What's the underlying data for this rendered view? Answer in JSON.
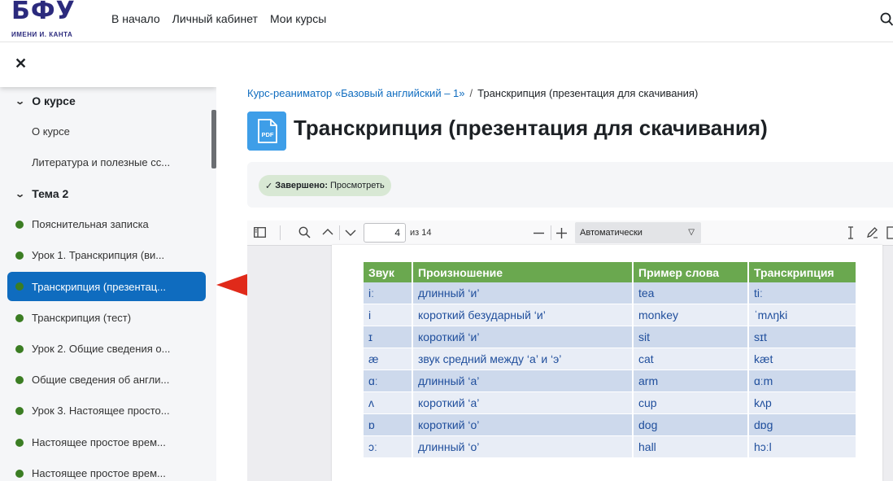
{
  "header": {
    "logo_main": "БФУ",
    "logo_sub": "ИМЕНИ И. КАНТА",
    "nav": [
      "В начало",
      "Личный кабинет",
      "Мои курсы"
    ]
  },
  "sidebar": {
    "sections": [
      {
        "title": "О курсе",
        "items": [
          "О курсе",
          "Литература и полезные сс..."
        ]
      },
      {
        "title": "Тема 2",
        "activities": [
          "Пояснительная записка",
          "Урок 1. Транскрипция (ви...",
          "Транскрипция (презентац...",
          "Транскрипция (тест)",
          "Урок 2. Общие сведения о...",
          "Общие сведения об англи...",
          "Урок 3. Настоящее просто...",
          "Настоящее простое врем...",
          "Настоящее простое врем..."
        ]
      }
    ]
  },
  "breadcrumb": {
    "course": "Курс-реаниматор «Базовый английский – 1»",
    "separator": "/",
    "current": "Транскрипция (презентация для скачивания)"
  },
  "page": {
    "icon_label": "PDF",
    "title": "Транскрипция (презентация для скачивания)",
    "completion_label": "Завершено:",
    "completion_value": "Просмотреть"
  },
  "viewer": {
    "page_number": "4",
    "page_total": "из 14",
    "zoom": "Автоматически"
  },
  "table": {
    "headers": [
      "Звук",
      "Произношение",
      "Пример слова",
      "Транскрипция"
    ],
    "rows": [
      [
        "iː",
        "длинный ‘и’",
        "tea",
        "tiː"
      ],
      [
        "i",
        "короткий безударный ‘и’",
        "monkey",
        "ˈmʌŋki"
      ],
      [
        "ɪ",
        "короткий ‘и’",
        "sit",
        "sɪt"
      ],
      [
        "æ",
        "звук средний между ‘а’ и ‘э’",
        "cat",
        "kæt"
      ],
      [
        "ɑː",
        "длинный ‘а’",
        "arm",
        "ɑːm"
      ],
      [
        "ʌ",
        "короткий ‘а’",
        "cup",
        "kʌp"
      ],
      [
        "ɒ",
        "короткий ‘о’",
        "dog",
        "dɒg"
      ],
      [
        "ɔː",
        "длинный ‘о’",
        "hall",
        "hɔːl"
      ]
    ]
  },
  "colors": {
    "brand": "#2b2a7d",
    "link": "#0f6cbf",
    "active_bg": "#0f6cbf",
    "dot": "#3b7d23",
    "table_header": "#6aa84f",
    "arrow": "#e02a1a"
  }
}
